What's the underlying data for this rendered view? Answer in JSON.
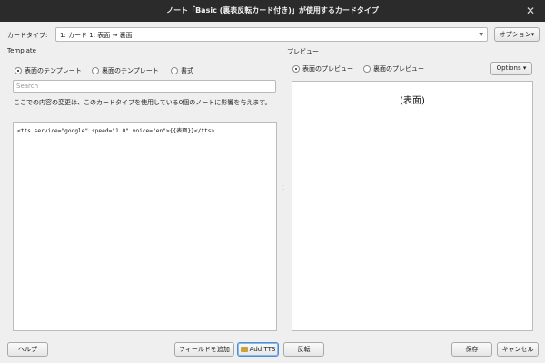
{
  "window": {
    "title": "ノート「Basic (裏表反転カード付き)」が使用するカードタイプ",
    "close_glyph": "✕"
  },
  "card_type": {
    "label": "カードタイプ:",
    "selected": "1: カード 1: 表面 → 裏面",
    "options_label": "オプション▾"
  },
  "template": {
    "section_label": "Template",
    "radios": [
      {
        "label": "表面のテンプレート",
        "checked": true
      },
      {
        "label": "裏面のテンプレート",
        "checked": false
      },
      {
        "label": "書式",
        "checked": false
      }
    ],
    "search_placeholder": "Search",
    "note": "ここでの内容の変更は、このカードタイプを使用している0個のノートに影響を与えます。",
    "code": "<tts service=\"google\" speed=\"1.0\" voice=\"en\">{{表面}}</tts>"
  },
  "preview": {
    "section_label": "プレビュー",
    "radios": [
      {
        "label": "表面のプレビュー",
        "checked": true
      },
      {
        "label": "裏面のプレビュー",
        "checked": false
      }
    ],
    "options_label": "Options ▾",
    "front_text": "(表面)"
  },
  "footer": {
    "help": "ヘルプ",
    "add_field": "フィールドを追加",
    "add_tts": "Add TTS",
    "flip": "反転",
    "save": "保存",
    "cancel": "キャンセル"
  }
}
